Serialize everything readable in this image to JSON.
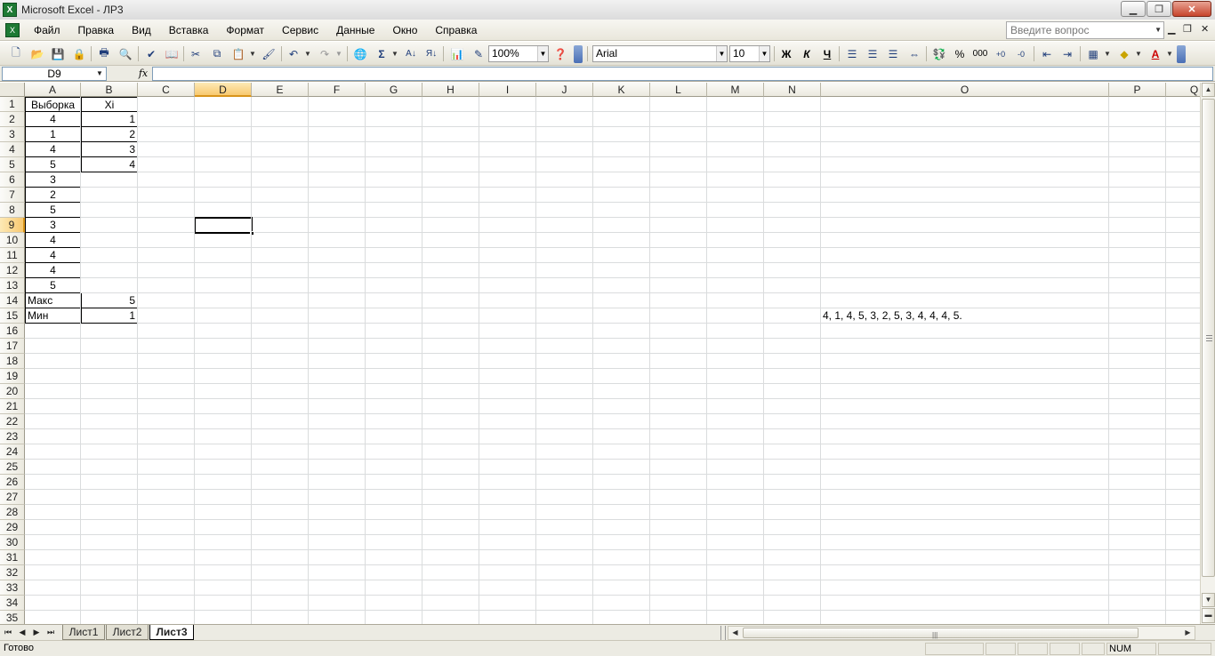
{
  "window": {
    "title": "Microsoft Excel - ЛР3"
  },
  "menu": {
    "items": [
      "Файл",
      "Правка",
      "Вид",
      "Вставка",
      "Формат",
      "Сервис",
      "Данные",
      "Окно",
      "Справка"
    ],
    "help_placeholder": "Введите вопрос"
  },
  "toolbar": {
    "zoom": "100%",
    "font": "Arial",
    "font_size": "10",
    "bold_label": "Ж",
    "italic_label": "К",
    "underline_label": "Ч",
    "percent_label": "%",
    "thousands_label": "000"
  },
  "formula_bar": {
    "cell_ref": "D9",
    "fx_label": "fx",
    "formula": ""
  },
  "columns": [
    "A",
    "B",
    "C",
    "D",
    "E",
    "F",
    "G",
    "H",
    "I",
    "J",
    "K",
    "L",
    "M",
    "N",
    "O",
    "P",
    "Q"
  ],
  "active_column": "D",
  "active_row": 9,
  "rows": [
    "1",
    "2",
    "3",
    "4",
    "5",
    "6",
    "7",
    "8",
    "9",
    "10",
    "11",
    "12",
    "13",
    "14",
    "15",
    "16",
    "17",
    "18",
    "19",
    "20",
    "21",
    "22",
    "23",
    "24",
    "25",
    "26",
    "27",
    "28",
    "29",
    "30",
    "31",
    "32",
    "33",
    "34",
    "35"
  ],
  "cells": {
    "A1": "Выборка",
    "B1": "Xi",
    "A2": "4",
    "B2": "1",
    "A3": "1",
    "B3": "2",
    "A4": "4",
    "B4": "3",
    "A5": "5",
    "B5": "4",
    "A6": "3",
    "A7": "2",
    "A8": "5",
    "A9": "3",
    "A10": "4",
    "A11": "4",
    "A12": "4",
    "A13": "5",
    "A14": "Макс",
    "B14": "5",
    "A15": "Мин",
    "B15": "1",
    "O15": "4, 1, 4, 5, 3, 2, 5, 3, 4, 4, 4, 5."
  },
  "sheets": [
    "Лист1",
    "Лист2",
    "Лист3"
  ],
  "active_sheet": "Лист3",
  "status": {
    "text": "Готово",
    "num": "NUM"
  }
}
